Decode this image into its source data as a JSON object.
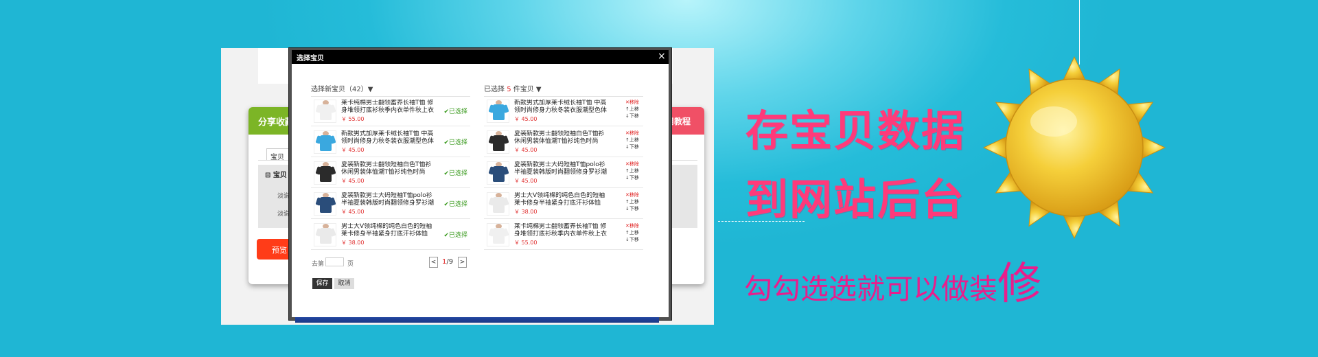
{
  "colors": {
    "accent_pink": "#ff3a7a",
    "accent_magenta": "#e81e8c",
    "check_green": "#3a9a1e",
    "price_red": "#e02020"
  },
  "background_page": {
    "share_label": "分享收藏",
    "tutorial_label": "用教程",
    "tab_label": "宝贝",
    "section_title": "宝贝",
    "row_labels": [
      "淡说",
      "淡说"
    ],
    "preview_label": "预览"
  },
  "modal": {
    "title": "选择宝贝",
    "close_icon": "close-icon",
    "left_header": {
      "prefix": "选择新宝贝（",
      "count": "42",
      "suffix": "）▼"
    },
    "right_header": {
      "prefix": "已选择 ",
      "count": "5",
      "suffix": " 件宝贝 ▼"
    },
    "left_items": [
      {
        "title": "莱卡纯棉男士翻领蓄养长袖T恤 修身堆领打底衫秋季内衣单件秋上衣",
        "price": "￥ 55.00",
        "status": "已选择",
        "shirt_color": "#f0f0f0"
      },
      {
        "title": "新款男式加厚莱卡绒长袖T恤 中高领时尚修身力秋冬装衣服潮型色体",
        "price": "￥ 45.00",
        "status": "已选择",
        "shirt_color": "#3aa8df"
      },
      {
        "title": "夏装新款男士翻领短袖白色T恤衫休闲男装体恤潮T恤衫纯色时尚polo",
        "price": "￥ 45.00",
        "status": "已选择",
        "shirt_color": "#2b2b2b"
      },
      {
        "title": "夏装新款男士大码短袖T恤polo衫半袖夏装韩版时尚翻领修身罗衫潮T",
        "price": "￥ 45.00",
        "status": "已选择",
        "shirt_color": "#2a4d7a"
      },
      {
        "title": "男士大V领纯棉的纯色白色的短袖莱卡修身半袖紧身打底汗衫体恤",
        "price": "￥ 38.00",
        "status": "已选择",
        "shirt_color": "#eaeaea"
      }
    ],
    "right_items": [
      {
        "title": "新款男式加厚莱卡绒长袖T恤 中高领时尚修身力秋冬装衣服潮型色体",
        "price": "￥ 45.00",
        "shirt_color": "#3aa8df"
      },
      {
        "title": "夏装新款男士翻领短袖白色T恤衫休闲男装体恤潮T恤衫纯色时尚polo",
        "price": "￥ 45.00",
        "shirt_color": "#2b2b2b"
      },
      {
        "title": "夏装新款男士大码短袖T恤polo衫半袖夏装韩版时尚翻领修身罗衫潮T",
        "price": "￥ 45.00",
        "shirt_color": "#2a4d7a"
      },
      {
        "title": "男士大V领纯棉的纯色白色的短袖莱卡修身半袖紧身打底汗衫体恤",
        "price": "￥ 38.00",
        "shirt_color": "#eaeaea"
      },
      {
        "title": "莱卡纯棉男士翻领蓄养长袖T恤 修身堆领打底衫秋季内衣单件秋上衣",
        "price": "￥ 55.00",
        "shirt_color": "#f0f0f0"
      }
    ],
    "ops": {
      "remove": "✕移除",
      "up": "↑上移",
      "down": "↓下移"
    },
    "pager": {
      "go_prefix": "去第",
      "go_suffix": "页",
      "current": "1",
      "total": "/9",
      "prev": "<",
      "next": ">"
    },
    "save_label": "保存",
    "cancel_label": "取消"
  },
  "promo": {
    "line1": "存宝贝数据",
    "line2": "到网站后台",
    "line3_main": "勾勾选选就可以做装",
    "line3_big": "修"
  }
}
